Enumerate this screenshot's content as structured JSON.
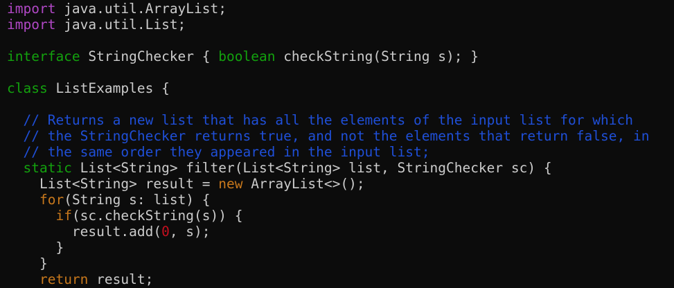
{
  "colors": {
    "background": "#0c0c0c",
    "plain": "#cccccc",
    "keyword": "#b148c6",
    "type": "#13a10e",
    "control": "#c8781c",
    "number": "#c50f1f",
    "comment": "#1f4fd8"
  },
  "lines": [
    {
      "tokens": [
        {
          "t": "import",
          "c": "keyword"
        },
        {
          "t": " java.util.ArrayList;",
          "c": "plain"
        }
      ]
    },
    {
      "tokens": [
        {
          "t": "import",
          "c": "keyword"
        },
        {
          "t": " java.util.List;",
          "c": "plain"
        }
      ]
    },
    {
      "tokens": []
    },
    {
      "tokens": [
        {
          "t": "interface",
          "c": "type"
        },
        {
          "t": " StringChecker { ",
          "c": "plain"
        },
        {
          "t": "boolean",
          "c": "type"
        },
        {
          "t": " checkString(String s); }",
          "c": "plain"
        }
      ]
    },
    {
      "tokens": []
    },
    {
      "tokens": [
        {
          "t": "class",
          "c": "type"
        },
        {
          "t": " ListExamples {",
          "c": "plain"
        }
      ]
    },
    {
      "tokens": []
    },
    {
      "tokens": [
        {
          "t": "  // Returns a new list that has all the elements of the input list for which",
          "c": "comment"
        }
      ]
    },
    {
      "tokens": [
        {
          "t": "  // the StringChecker returns true, and not the elements that return false, in",
          "c": "comment"
        }
      ]
    },
    {
      "tokens": [
        {
          "t": "  // the same order they appeared in the input list;",
          "c": "comment"
        }
      ]
    },
    {
      "tokens": [
        {
          "t": "  ",
          "c": "plain"
        },
        {
          "t": "static",
          "c": "type"
        },
        {
          "t": " List<String> filter(List<String> list, StringChecker sc) {",
          "c": "plain"
        }
      ]
    },
    {
      "tokens": [
        {
          "t": "    List<String> result = ",
          "c": "plain"
        },
        {
          "t": "new",
          "c": "control"
        },
        {
          "t": " ArrayList<>();",
          "c": "plain"
        }
      ]
    },
    {
      "tokens": [
        {
          "t": "    ",
          "c": "plain"
        },
        {
          "t": "for",
          "c": "control"
        },
        {
          "t": "(String s: list) {",
          "c": "plain"
        }
      ]
    },
    {
      "tokens": [
        {
          "t": "      ",
          "c": "plain"
        },
        {
          "t": "if",
          "c": "control"
        },
        {
          "t": "(sc.checkString(s)) {",
          "c": "plain"
        }
      ]
    },
    {
      "tokens": [
        {
          "t": "        result.add(",
          "c": "plain"
        },
        {
          "t": "0",
          "c": "number"
        },
        {
          "t": ", s);",
          "c": "plain"
        }
      ]
    },
    {
      "tokens": [
        {
          "t": "      }",
          "c": "plain"
        }
      ]
    },
    {
      "tokens": [
        {
          "t": "    }",
          "c": "plain"
        }
      ]
    },
    {
      "tokens": [
        {
          "t": "    ",
          "c": "plain"
        },
        {
          "t": "return",
          "c": "control"
        },
        {
          "t": " result;",
          "c": "plain"
        }
      ]
    }
  ]
}
